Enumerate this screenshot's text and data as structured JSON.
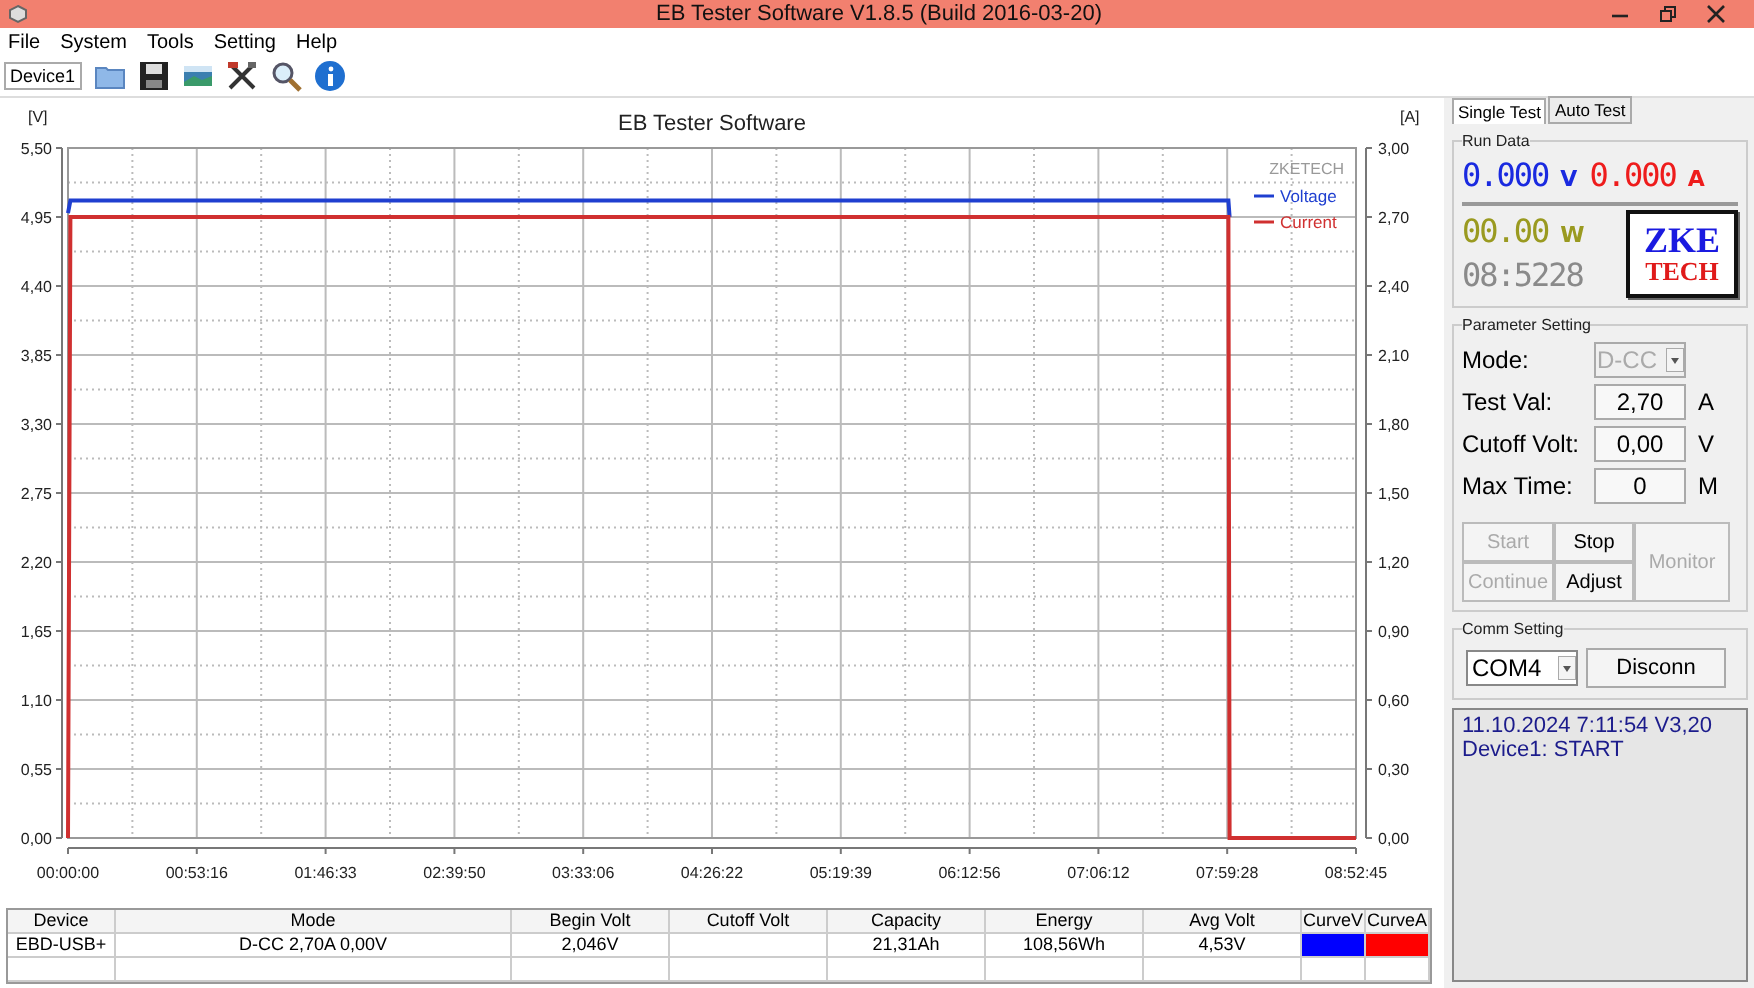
{
  "window": {
    "title": "EB Tester Software V1.8.5 (Build 2016-03-20)"
  },
  "menu": [
    "File",
    "System",
    "Tools",
    "Setting",
    "Help"
  ],
  "toolbar": {
    "device_tab": "Device1"
  },
  "chart": {
    "brand": "ZKETECH",
    "chart_data": {
      "type": "line",
      "title": "EB Tester Software",
      "ylabel": "[V]",
      "y2label": "[A]",
      "x": [
        0,
        60,
        28800,
        28830,
        31965
      ],
      "series": [
        {
          "name": "Voltage",
          "color": "#1f3fd0",
          "values": [
            4.98,
            5.08,
            5.08,
            4.95,
            null
          ]
        },
        {
          "name": "Current",
          "color": "#d03030",
          "axis": "y2",
          "values": [
            0,
            2.7,
            2.7,
            0,
            0
          ]
        }
      ],
      "grid": true,
      "legend": "upper right",
      "xlim": [
        0,
        31965
      ],
      "ylim": [
        0,
        5.5
      ],
      "y2lim": [
        0,
        3
      ],
      "xticks": [
        {
          "value": 0,
          "label": "00:00:00"
        },
        {
          "value": 3196,
          "label": "00:53:16"
        },
        {
          "value": 6393,
          "label": "01:46:33"
        },
        {
          "value": 9590,
          "label": "02:39:50"
        },
        {
          "value": 12786,
          "label": "03:33:06"
        },
        {
          "value": 15982,
          "label": "04:26:22"
        },
        {
          "value": 19179,
          "label": "05:19:39"
        },
        {
          "value": 22376,
          "label": "06:12:56"
        },
        {
          "value": 25572,
          "label": "07:06:12"
        },
        {
          "value": 28768,
          "label": "07:59:28"
        },
        {
          "value": 31965,
          "label": "08:52:45"
        }
      ],
      "yticks": [
        {
          "value": 0,
          "label": "0,00"
        },
        {
          "value": 0.55,
          "label": "0,55"
        },
        {
          "value": 1.1,
          "label": "1,10"
        },
        {
          "value": 1.65,
          "label": "1,65"
        },
        {
          "value": 2.2,
          "label": "2,20"
        },
        {
          "value": 2.75,
          "label": "2,75"
        },
        {
          "value": 3.3,
          "label": "3,30"
        },
        {
          "value": 3.85,
          "label": "3,85"
        },
        {
          "value": 4.4,
          "label": "4,40"
        },
        {
          "value": 4.95,
          "label": "4,95"
        },
        {
          "value": 5.5,
          "label": "5,50"
        }
      ],
      "y2ticks": [
        {
          "value": 0,
          "label": "0,00"
        },
        {
          "value": 0.3,
          "label": "0,30"
        },
        {
          "value": 0.6,
          "label": "0,60"
        },
        {
          "value": 0.9,
          "label": "0,90"
        },
        {
          "value": 1.2,
          "label": "1,20"
        },
        {
          "value": 1.5,
          "label": "1,50"
        },
        {
          "value": 1.8,
          "label": "1,80"
        },
        {
          "value": 2.1,
          "label": "2,10"
        },
        {
          "value": 2.4,
          "label": "2,40"
        },
        {
          "value": 2.7,
          "label": "2,70"
        },
        {
          "value": 3,
          "label": "3,00"
        }
      ]
    }
  },
  "table": {
    "columns": [
      "Device",
      "Mode",
      "Begin Volt",
      "Cutoff Volt",
      "Capacity",
      "Energy",
      "Avg Volt",
      "CurveV",
      "CurveA"
    ],
    "rows": [
      {
        "cells": [
          {
            "text": "EBD-USB+"
          },
          {
            "text": "D-CC  2,70A  0,00V"
          },
          {
            "text": "2,046V"
          },
          {},
          {
            "text": "21,31Ah"
          },
          {
            "text": "108,56Wh"
          },
          {
            "text": "4,53V"
          },
          {
            "color": "#0000ff"
          },
          {
            "color": "#ff0000"
          }
        ]
      }
    ]
  },
  "right_panel": {
    "tabs": [
      {
        "label": "Single Test",
        "selected": true
      },
      {
        "label": "Auto Test",
        "selected": false
      }
    ],
    "run_data": {
      "title": "Run Data",
      "voltage": {
        "value": "0.000",
        "unit": "V"
      },
      "current": {
        "value": "0.000",
        "unit": "A"
      },
      "power": {
        "value": "00.00",
        "unit": "W"
      },
      "time": "08:5228",
      "logo": {
        "line_1": "ZKE",
        "line_2": "TECH"
      }
    },
    "parameter_setting": {
      "title": "Parameter Setting",
      "fields": [
        {
          "kind": "select",
          "label": "Mode:",
          "value": "D-CC",
          "disabled": true
        },
        {
          "kind": "input",
          "label": "Test Val:",
          "value": "2,70",
          "unit": "A",
          "disabled": false
        },
        {
          "kind": "input",
          "label": "Cutoff Volt:",
          "value": "0,00",
          "unit": "V",
          "disabled": false
        },
        {
          "kind": "input",
          "label": "Max Time:",
          "value": "0",
          "unit": "M",
          "disabled": false
        }
      ],
      "buttons": [
        {
          "label": "Start",
          "disabled": true,
          "kind": "normal"
        },
        {
          "label": "Stop",
          "disabled": false,
          "kind": "normal"
        },
        {
          "label": "Monitor",
          "disabled": true,
          "kind": "tall"
        },
        {
          "label": "Continue",
          "disabled": true,
          "kind": "normal"
        },
        {
          "label": "Adjust",
          "disabled": false,
          "kind": "normal"
        }
      ]
    },
    "comm_setting": {
      "title": "Comm Setting",
      "port": "COM4",
      "button": "Disconn"
    },
    "log": [
      "11.10.2024 7:11:54  V3,20",
      "Device1: START"
    ]
  }
}
